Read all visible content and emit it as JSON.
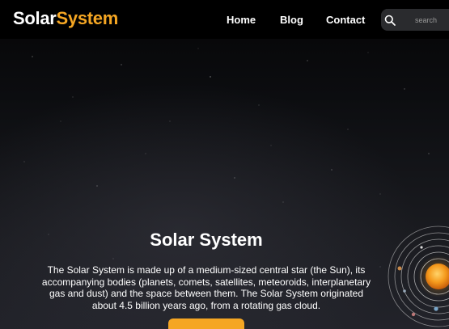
{
  "header": {
    "logo_part1": "Solar",
    "logo_part2": "System",
    "nav": [
      {
        "label": "Home"
      },
      {
        "label": "Blog"
      },
      {
        "label": "Contact"
      }
    ],
    "search_placeholder": "search"
  },
  "hero": {
    "title": "Solar System",
    "description": "The Solar System is made up of a medium-sized central star (the Sun), its accompanying bodies (planets, comets, satellites, meteoroids, interplanetary gas and dust) and the space between them. The Solar System originated about 4.5 billion years ago, from a rotating gas cloud.",
    "cta_label": ""
  },
  "colors": {
    "accent": "#f5a623",
    "header_bg": "#000000",
    "text": "#ffffff",
    "search_bg": "#2a2b2e"
  },
  "icons": {
    "search": "search-icon",
    "solar": "solar-system-icon"
  }
}
